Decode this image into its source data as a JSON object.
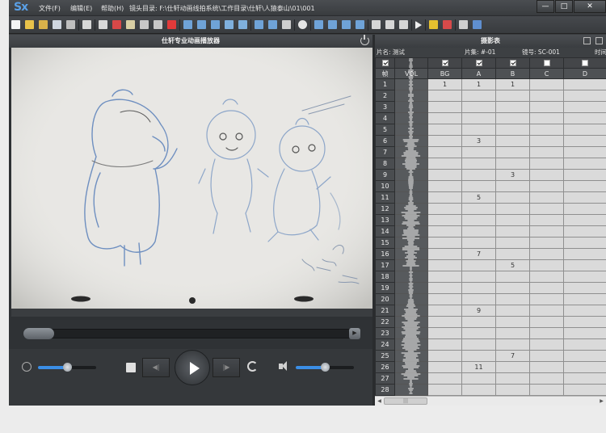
{
  "app": {
    "logo": "Sx",
    "menus": [
      "文件(F)",
      "编辑(E)",
      "帮助(H)"
    ],
    "path_label": "镜头目录: F:\\仕轩动画线拍系统\\工作目录\\仕轩\\人猿泰山\\01\\001",
    "window_controls": [
      "—",
      "□",
      "✕"
    ]
  },
  "player": {
    "title": "仕轩专业动画播放器",
    "seek_left_label": "|  ∥",
    "seek_right_label": "▶",
    "skip_back_label": "◀|",
    "skip_fwd_label": "|▶",
    "speed_level": 0.5,
    "volume_level": 0.5
  },
  "sheet": {
    "title": "摄影表",
    "film_label": "片名: 测试",
    "episode_label": "片集: #-01",
    "shot_label": "镜号: SC-001",
    "time_label": "时间",
    "columns": [
      "帧",
      "VOL",
      "BG",
      "A",
      "B",
      "C",
      "D"
    ],
    "column_checked": [
      true,
      true,
      true,
      true,
      false,
      false
    ],
    "rows": [
      {
        "frame": "1",
        "BG": "1",
        "A": "1",
        "B": "1"
      },
      {
        "frame": "2"
      },
      {
        "frame": "3"
      },
      {
        "frame": "4"
      },
      {
        "frame": "5"
      },
      {
        "frame": "6",
        "A": "3"
      },
      {
        "frame": "7"
      },
      {
        "frame": "8"
      },
      {
        "frame": "9",
        "B": "3"
      },
      {
        "frame": "10"
      },
      {
        "frame": "11",
        "A": "5"
      },
      {
        "frame": "12"
      },
      {
        "frame": "13"
      },
      {
        "frame": "14"
      },
      {
        "frame": "15"
      },
      {
        "frame": "16",
        "A": "7"
      },
      {
        "frame": "17",
        "B": "5"
      },
      {
        "frame": "18"
      },
      {
        "frame": "19"
      },
      {
        "frame": "20"
      },
      {
        "frame": "21",
        "A": "9"
      },
      {
        "frame": "22"
      },
      {
        "frame": "23"
      },
      {
        "frame": "24"
      },
      {
        "frame": "25",
        "B": "7"
      },
      {
        "frame": "26",
        "A": "11"
      },
      {
        "frame": "27"
      },
      {
        "frame": "28"
      }
    ],
    "scroll_thumb_label": "|||"
  }
}
